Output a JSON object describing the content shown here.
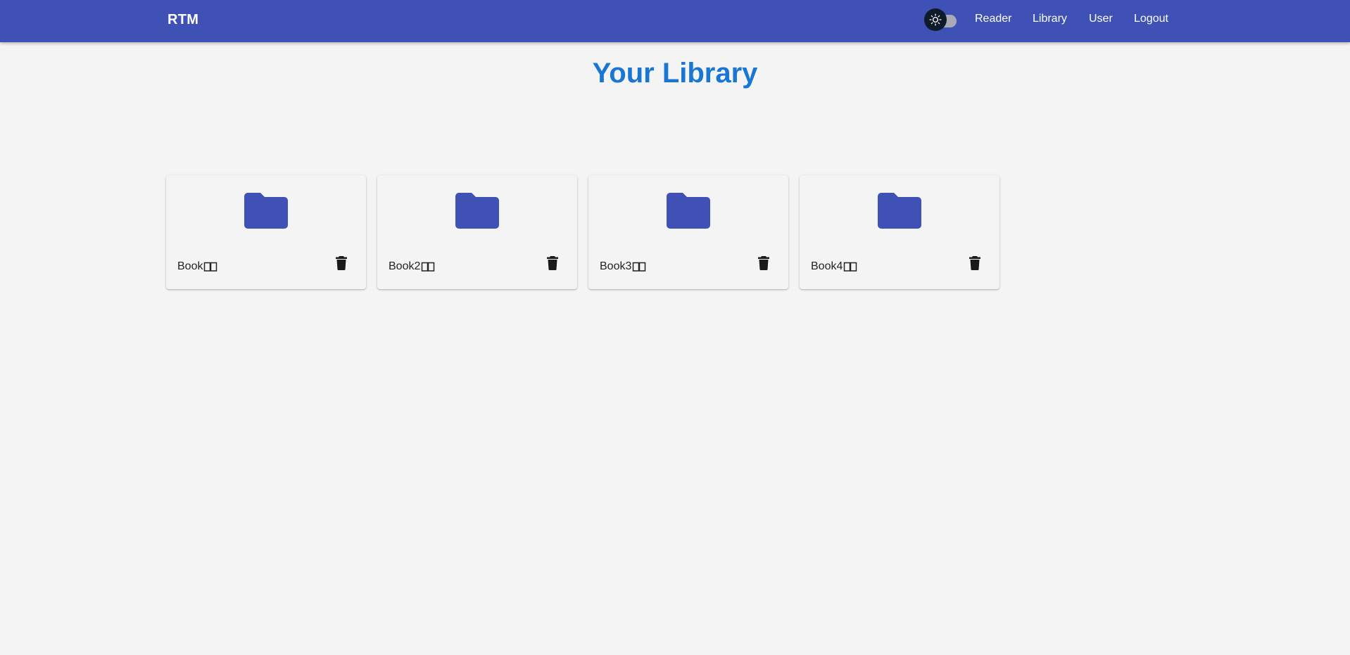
{
  "header": {
    "brand": "RTM",
    "nav": [
      "Reader",
      "Library",
      "User",
      "Logout"
    ],
    "theme_toggle_icon": "sun-icon",
    "bar_color": "#3f51b5"
  },
  "main": {
    "title": "Your Library",
    "title_color": "#1976d2",
    "books": [
      {
        "name": "Book",
        "icon": "folder-icon",
        "action_icon": "trash-icon"
      },
      {
        "name": "Book2",
        "icon": "folder-icon",
        "action_icon": "trash-icon"
      },
      {
        "name": "Book3",
        "icon": "folder-icon",
        "action_icon": "trash-icon"
      },
      {
        "name": "Book4",
        "icon": "folder-icon",
        "action_icon": "trash-icon"
      }
    ]
  }
}
